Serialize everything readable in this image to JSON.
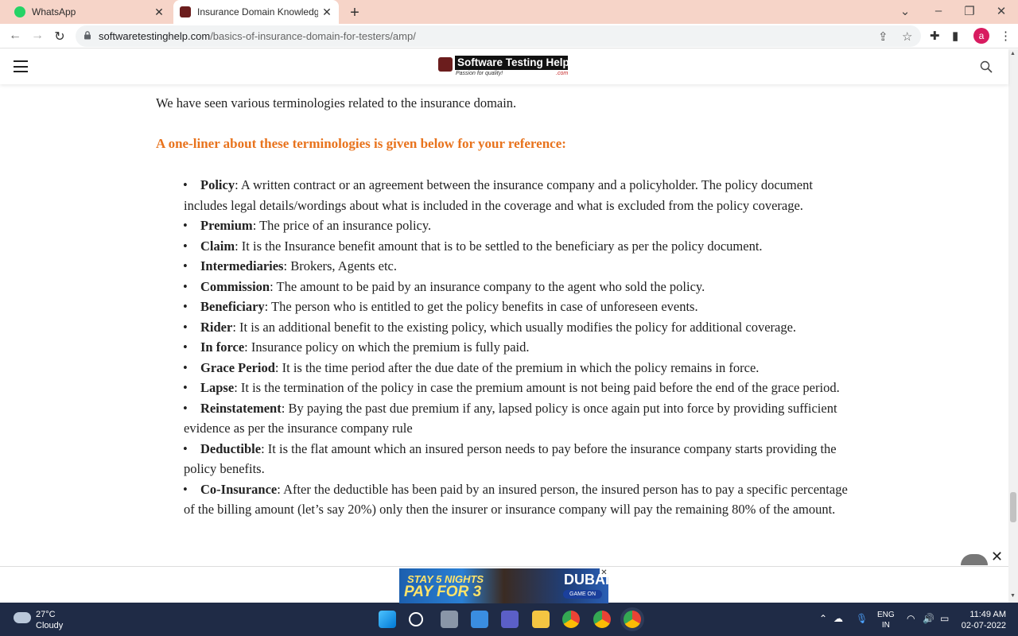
{
  "tabs": [
    {
      "title": "WhatsApp"
    },
    {
      "title": "Insurance Domain Knowledge: Basics"
    }
  ],
  "address_bar": {
    "domain": "softwaretestinghelp.com",
    "path": "/basics-of-insurance-domain-for-testers/amp/"
  },
  "profile_initial": "a",
  "site": {
    "logo_text": "Software Testing Help",
    "logo_tagline": "Passion for quality!",
    "logo_suffix": ".com"
  },
  "article": {
    "intro": "We have seen various terminologies related to the insurance domain.",
    "heading": "A one-liner about these terminologies is given below for your reference:",
    "terms": [
      {
        "term": "Policy",
        "definition": ": A written contract or an agreement between the insurance company and a policyholder. The policy document includes legal details/wordings about what is included in the coverage and what is excluded from the policy coverage."
      },
      {
        "term": "Premium",
        "definition": ": The price of an insurance policy."
      },
      {
        "term": "Claim",
        "definition": ": It is the Insurance benefit amount that is to be settled to the beneficiary as per the policy document."
      },
      {
        "term": "Intermediaries",
        "definition": ": Brokers, Agents etc."
      },
      {
        "term": "Commission",
        "definition": ": The amount to be paid by an insurance company to the agent who sold the policy."
      },
      {
        "term": "Beneficiary",
        "definition": ": The person who is entitled to get the policy benefits in case of unforeseen events."
      },
      {
        "term": "Rider",
        "definition": ": It is an additional benefit to the existing policy, which usually modifies the policy for additional coverage."
      },
      {
        "term": "In force",
        "definition": ": Insurance policy on which the premium is fully paid."
      },
      {
        "term": "Grace Period",
        "definition": ": It is the time period after the due date of the premium in which the policy remains in force."
      },
      {
        "term": "Lapse",
        "definition": ": It is the termination of the policy in case the premium amount is not being paid before the end of the grace period."
      },
      {
        "term": "Reinstatement",
        "definition": ": By paying the past due premium if any, lapsed policy is once again put into force by providing sufficient evidence as per the insurance company rule"
      },
      {
        "term": "Deductible",
        "definition": ": It is the flat amount which an insured person needs to pay before the insurance company starts providing the policy benefits."
      },
      {
        "term": "Co-Insurance",
        "definition": ": After the deductible has been paid by an insured person, the insured person has to pay a specific percentage of the billing amount (let’s say 20%) only then the insurer or insurance company will pay the remaining 80% of the amount."
      }
    ]
  },
  "ad": {
    "line1": "STAY 5 NIGHTS",
    "line2": "PAY FOR 3",
    "brand": "DUBAI",
    "cta": "GAME ON"
  },
  "taskbar": {
    "temperature": "27°C",
    "condition": "Cloudy",
    "lang_top": "ENG",
    "lang_bottom": "IN",
    "time": "11:49 AM",
    "date": "02-07-2022"
  }
}
